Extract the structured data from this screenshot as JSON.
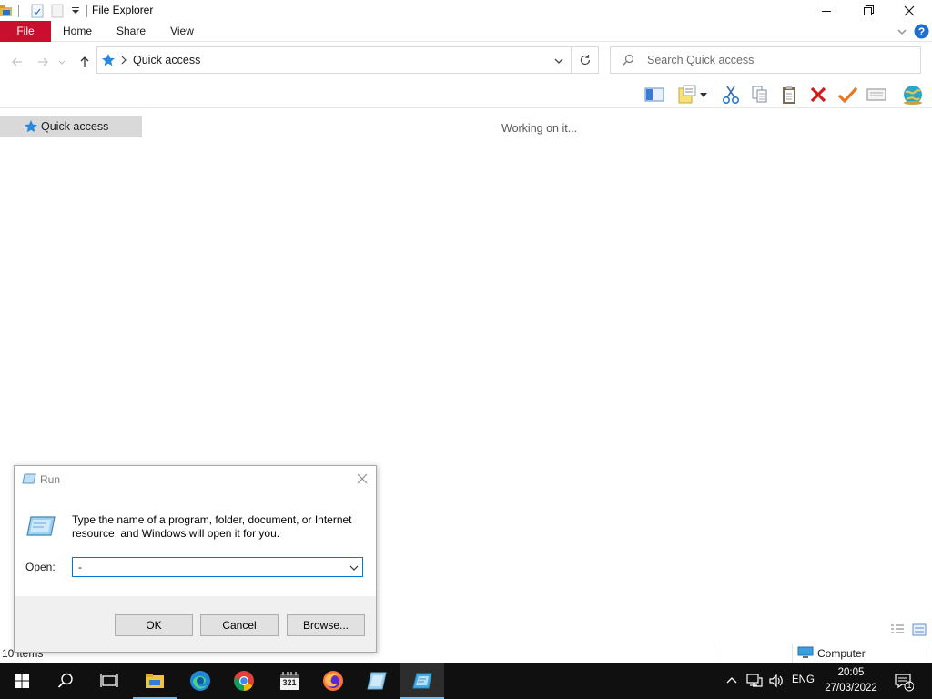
{
  "window": {
    "title": "File Explorer"
  },
  "ribbon": {
    "tabs": [
      "File",
      "Home",
      "Share",
      "View"
    ]
  },
  "address": {
    "location": "Quick access",
    "search_placeholder": "Search Quick access"
  },
  "navigation": {
    "items": [
      "Quick access"
    ]
  },
  "content": {
    "status_message": "Working on it..."
  },
  "statusbar": {
    "item_count": "10 items",
    "location_label": "Computer"
  },
  "run_dialog": {
    "title": "Run",
    "description": "Type the name of a program, folder, document, or Internet resource, and Windows will open it for you.",
    "open_label": "Open:",
    "open_value": "-",
    "ok_label": "OK",
    "cancel_label": "Cancel",
    "browse_label": "Browse..."
  },
  "taskbar": {
    "language": "ENG",
    "time": "20:05",
    "date": "27/03/2022",
    "notification_count": "1",
    "calendar_app_number": "321"
  },
  "colors": {
    "file_tab": "#c8102e",
    "accent_blue": "#0078d7",
    "taskbar": "#101010",
    "nav_selected": "#d9d9d9"
  }
}
